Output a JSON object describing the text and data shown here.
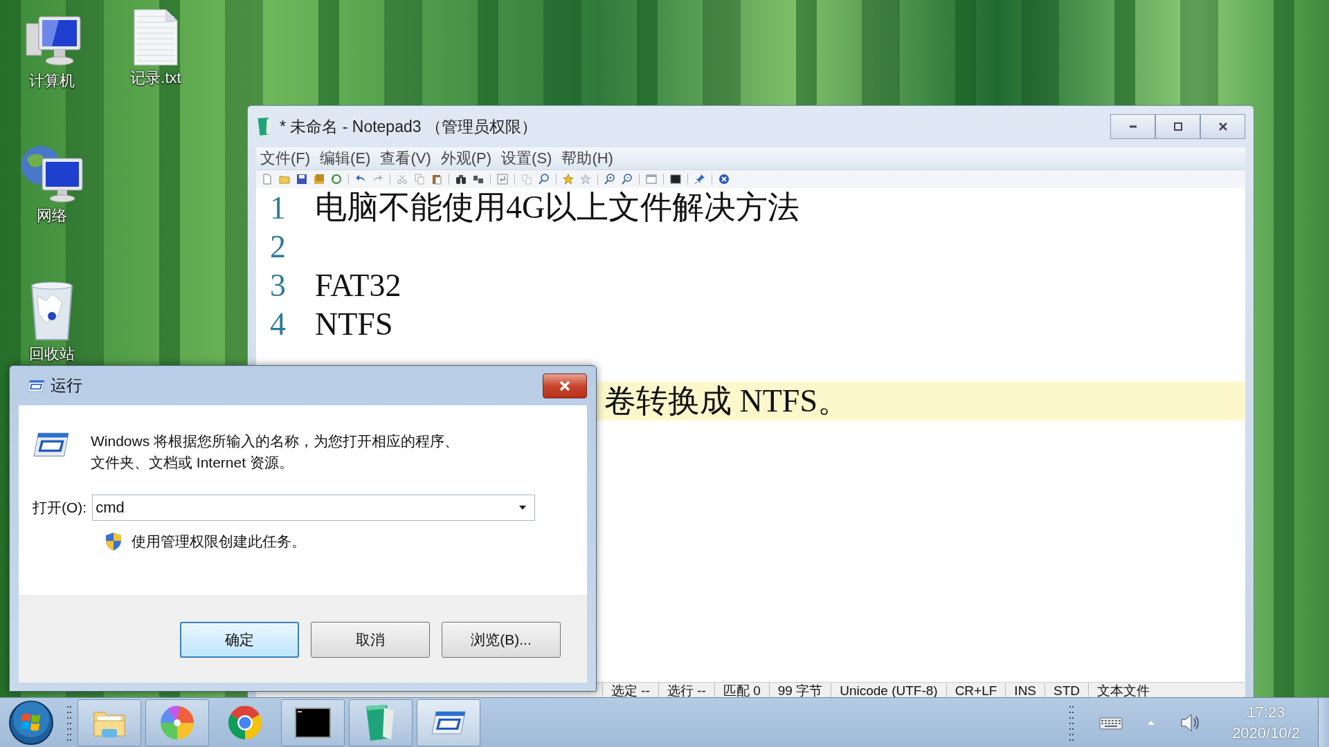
{
  "desktop_icons": [
    {
      "kind": "computer",
      "label": "计算机"
    },
    {
      "kind": "text-file",
      "label": "记录.txt"
    },
    {
      "kind": "network",
      "label": "网络"
    },
    {
      "kind": "recycle-bin",
      "label": "回收站"
    }
  ],
  "editor_window": {
    "title": "* 未命名 - Notepad3 （管理员权限）",
    "menu": [
      "文件(F)",
      "编辑(E)",
      "查看(V)",
      "外观(P)",
      "设置(S)",
      "帮助(H)"
    ],
    "lines": [
      {
        "number": "1",
        "text": "电脑不能使用4G以上文件解决方法",
        "current": false
      },
      {
        "number": "2",
        "current": false
      },
      {
        "number": "3",
        "text": "FAT32",
        "current": false
      },
      {
        "number": "4",
        "text": "NTFS",
        "current": false
      },
      {
        "current": false
      },
      {
        "text": "卷转换成 NTFS。",
        "current": true
      }
    ],
    "status_bar": [
      "选定 --",
      "选行 --",
      "匹配 0",
      "99 字节",
      "Unicode (UTF-8)",
      "CR+LF",
      "INS",
      "STD",
      "文本文件"
    ]
  },
  "run_dialog": {
    "title": "运行",
    "description": [
      "Windows 将根据您所输入的名称，为您打开相应的程序、",
      "文件夹、文档或 Internet 资源。"
    ],
    "open_label": "打开(O):",
    "open_value": "cmd",
    "admin_note": "使用管理权限创建此任务。",
    "buttons": [
      {
        "label": "确定",
        "default": true
      },
      {
        "label": "取消",
        "default": false
      },
      {
        "label": "浏览(B)...",
        "default": false
      }
    ]
  },
  "taskbar": {
    "apps": [
      {
        "kind": "file-explorer",
        "running": true,
        "active": false
      },
      {
        "kind": "pinwheel",
        "running": true,
        "active": false
      },
      {
        "kind": "chrome",
        "running": false,
        "active": false
      },
      {
        "kind": "console",
        "running": true,
        "active": false
      },
      {
        "kind": "notepad",
        "running": true,
        "active": false
      },
      {
        "kind": "run",
        "running": true,
        "active": true
      }
    ],
    "clock": {
      "time": "17:23",
      "date": "2020/10/2"
    }
  }
}
